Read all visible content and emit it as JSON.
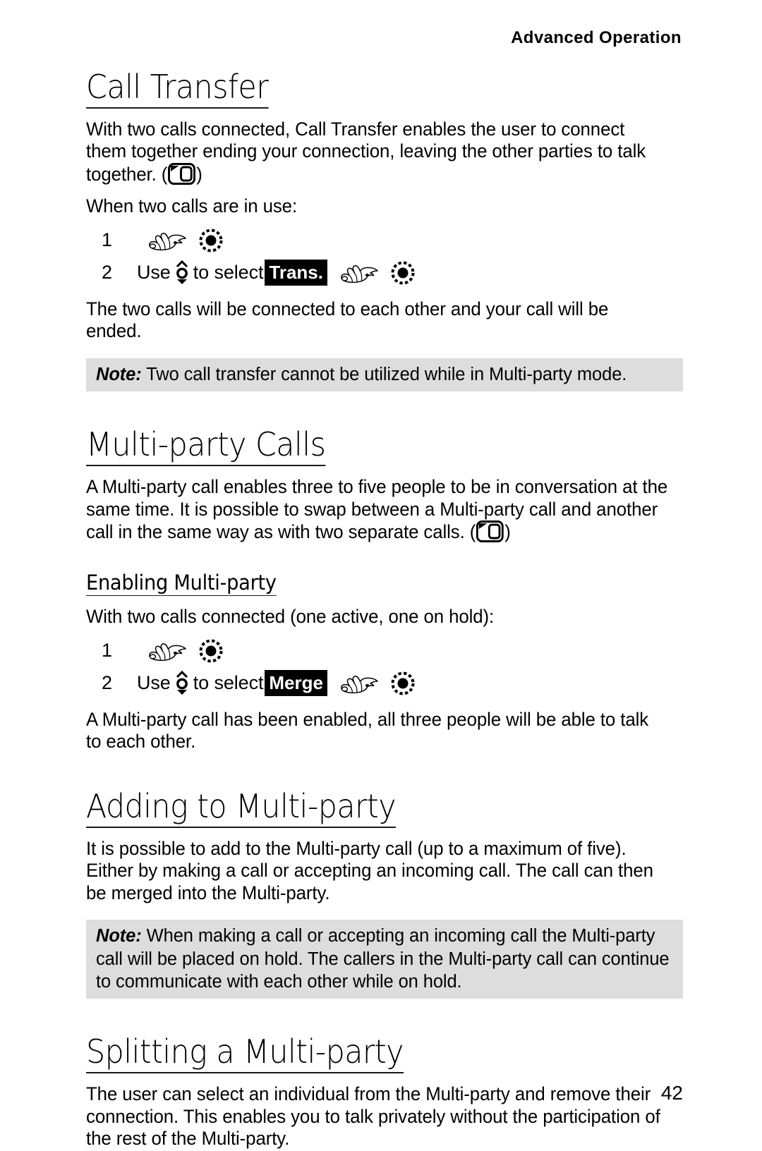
{
  "header": {
    "running_head": "Advanced Operation"
  },
  "sections": [
    {
      "title": "Call Transfer",
      "intro_part1": "With two calls connected, Call Transfer enables the user to connect them together ending your connection, leaving the other parties to talk together. (",
      "intro_part2": ")",
      "lead_in": "When two calls are in use:",
      "steps": [
        {
          "num": "1"
        },
        {
          "num": "2",
          "text_before": "Use",
          "text_middle": "to select",
          "softkey": "Trans."
        }
      ],
      "outcome": "The two calls will be connected to each other and your call will be ended.",
      "note_label": "Note:",
      "note_text": " Two call transfer cannot be utilized while in Multi-party mode."
    },
    {
      "title": "Multi-party Calls",
      "intro_part1": "A Multi-party call enables three to five people to be in conversation at the same time. It is possible to swap between a Multi-party call and another call in the same way as with two separate calls. (",
      "intro_part2": ")",
      "subsection": {
        "title": "Enabling Multi-party",
        "lead_in": "With two calls connected (one active, one on hold):",
        "steps": [
          {
            "num": "1"
          },
          {
            "num": "2",
            "text_before": "Use",
            "text_middle": "to select",
            "softkey": "Merge"
          }
        ],
        "outcome": "A Multi-party call has been enabled, all three people will be able to talk to each other."
      }
    },
    {
      "title": "Adding to Multi-party",
      "intro": "It is possible to add to the Multi-party call (up to a maximum of five). Either by making a call or accepting an incoming call. The call can then be merged into the Multi-party.",
      "note_label": "Note:",
      "note_text": " When making a call or accepting an incoming call the Multi-party call will be placed on hold. The callers in the Multi-party call can continue to communicate with each other while on hold."
    },
    {
      "title": "Splitting a Multi-party",
      "intro": "The user can select an individual from the Multi-party and remove their connection. This enables you to talk privately without the participation of the rest of the Multi-party."
    }
  ],
  "icons": {
    "hand": "pointing-hand-icon",
    "press": "press-key-icon",
    "navigation": "up-down-navigation-key-icon",
    "display": "handset-display-icon"
  },
  "footer": {
    "page_number": "42"
  },
  "colors": {
    "text": "#000000",
    "note_background": "#dddddd",
    "softkey_background": "#000000",
    "softkey_text": "#ffffff"
  }
}
